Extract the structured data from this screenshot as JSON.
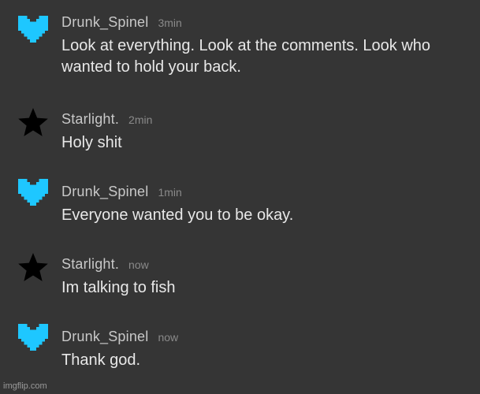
{
  "colors": {
    "background": "#353535",
    "heart": "#1ec7ff",
    "star": "#000000"
  },
  "messages": [
    {
      "username": "Drunk_Spinel",
      "time": "3min",
      "avatar_icon": "pixel-heart-icon",
      "text": "Look at everything. Look at the comments. Look who wanted to hold your back."
    },
    {
      "username": "Starlight.",
      "time": "2min",
      "avatar_icon": "star-icon",
      "text": "Holy shit"
    },
    {
      "username": "Drunk_Spinel",
      "time": "1min",
      "avatar_icon": "pixel-heart-icon",
      "text": "Everyone wanted you to be okay."
    },
    {
      "username": "Starlight.",
      "time": "now",
      "avatar_icon": "star-icon",
      "text": "Im talking to fish"
    },
    {
      "username": "Drunk_Spinel",
      "time": "now",
      "avatar_icon": "pixel-heart-icon",
      "text": "Thank god."
    }
  ],
  "watermark": "imgflip.com"
}
